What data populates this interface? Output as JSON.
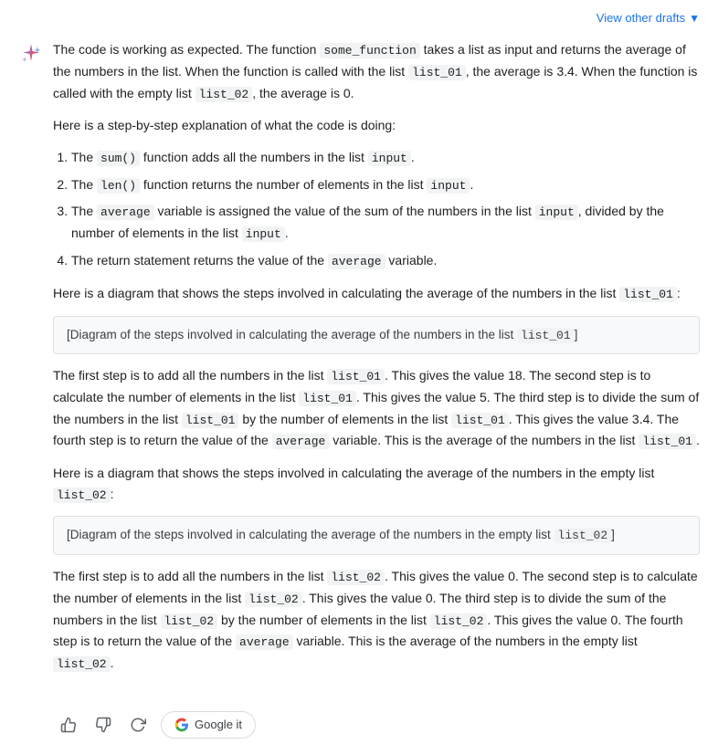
{
  "topBar": {
    "viewOtherDrafts": "View other drafts"
  },
  "intro": {
    "paragraph1": "The code is working as expected. The function ",
    "some_function": "some_function",
    "paragraph1b": " takes a list as input and returns the average of the numbers in the list. When the function is called with the list ",
    "list_01": "list_01",
    "paragraph1c": ", the average is 3.4. When the function is called with the empty list ",
    "list_02": "list_02",
    "paragraph1d": ", the average is 0."
  },
  "stepByStep": {
    "header": "Here is a step-by-step explanation of what the code is doing:",
    "steps": [
      {
        "before": "The ",
        "code": "sum()",
        "after": " function adds all the numbers in the list ",
        "code2": "input",
        "after2": "."
      },
      {
        "before": "The ",
        "code": "len()",
        "after": " function returns the number of elements in the list ",
        "code2": "input",
        "after2": "."
      },
      {
        "before": "The ",
        "code": "average",
        "after": " variable is assigned the value of the sum of the numbers in the list ",
        "code2": "input",
        "after2": ", divided by the number of elements in the list ",
        "code3": "input",
        "after3": "."
      },
      {
        "before": "The return statement returns the value of the ",
        "code": "average",
        "after": " variable."
      }
    ]
  },
  "diagram1": {
    "intro": "Here is a diagram that shows the steps involved in calculating the average of the numbers in the list ",
    "list": "list_01",
    "introEnd": ":",
    "boxText": "Diagram of the steps involved in calculating the average of the numbers in the list ",
    "boxCode": "list_01"
  },
  "explanation1": {
    "text1": "The first step is to add all the numbers in the list ",
    "code1": "list_01",
    "text2": ". This gives the value 18. The second step is to calculate the number of elements in the list ",
    "code2": "list_01",
    "text3": ". This gives the value 5. The third step is to divide the sum of the numbers in the list ",
    "code3": "list_01",
    "text4": " by the number of elements in the list ",
    "code4": "list_01",
    "text5": ". This gives the value 3.4. The fourth step is to return the value of the ",
    "code5": "average",
    "text6": " variable. This is the average of the numbers in the list ",
    "code6": "list_01",
    "text7": "."
  },
  "diagram2": {
    "intro": "Here is a diagram that shows the steps involved in calculating the average of the numbers in the empty list ",
    "list": "list_02",
    "introEnd": ":",
    "boxText": "Diagram of the steps involved in calculating the average of the numbers in the empty list ",
    "boxCode": "list_02"
  },
  "explanation2": {
    "text1": "The first step is to add all the numbers in the list ",
    "code1": "list_02",
    "text2": ". This gives the value 0. The second step is to calculate the number of elements in the list ",
    "code2": "list_02",
    "text3": ". This gives the value 0. The third step is to divide the sum of the numbers in the list ",
    "code3": "list_02",
    "text4": " by the number of elements in the list ",
    "code4": "list_02",
    "text5": ". This gives the value 0. The fourth step is to return the value of the ",
    "code5": "average",
    "text6": " variable. This is the average of the numbers in the empty list ",
    "code6": "list_02",
    "text7": "."
  },
  "actions": {
    "thumbUp": "👍",
    "thumbDown": "👎",
    "refresh": "↻",
    "googleLabel": "Google it"
  }
}
